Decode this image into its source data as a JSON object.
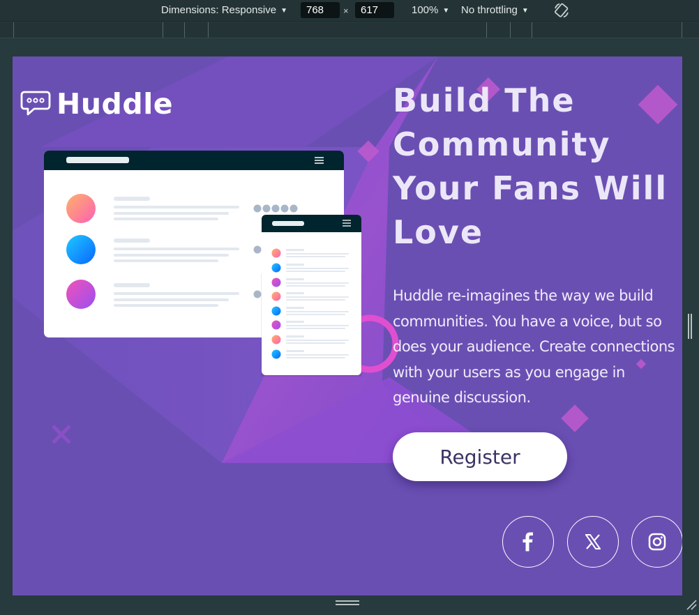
{
  "devtools": {
    "dimensions_label": "Dimensions: Responsive",
    "width": "768",
    "height": "617",
    "times": "×",
    "zoom": "100%",
    "throttling": "No throttling",
    "caret": "▼"
  },
  "page": {
    "brand": "Huddle",
    "headline": "Build The Community Your Fans Will Love",
    "description": "Huddle re-imagines the way we build communities. You have a voice, but so does your audience. Create connections with your users as you engage in genuine discussion.",
    "register_label": "Register",
    "social": [
      "facebook-icon",
      "x-icon",
      "instagram-icon"
    ]
  },
  "colors": {
    "background": "#6a4fb3",
    "accent_magenta": "#d05ad6",
    "button_text": "#3a3363",
    "mockup_header": "#00252e"
  }
}
